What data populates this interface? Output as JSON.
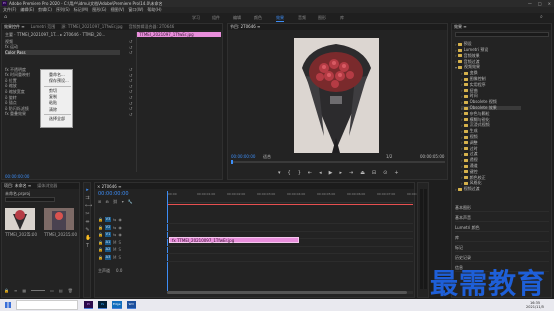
{
  "titlebar": {
    "title": "Adobe Premiere Pro 2020 - C:\\用户\\idmu\\文档\\Adobe\\Premiere Pro\\14.0\\未命名"
  },
  "menubar": {
    "items": [
      "文件(F)",
      "编辑(E)",
      "剪辑(C)",
      "序列(S)",
      "标记(M)",
      "图形(G)",
      "视图(V)",
      "窗口(W)",
      "帮助(H)"
    ]
  },
  "workspaces": {
    "items": [
      "学习",
      "组件",
      "编辑",
      "颜色",
      "效果",
      "音频",
      "图形",
      "库"
    ],
    "active_index": 4
  },
  "effect_controls": {
    "tabs": [
      "效果控件 ≡",
      "Lumetri 范围",
      "源: TTMEI_2021097_1TfwEr.jpg",
      "音频剪辑混合器: 2T0646"
    ],
    "clip_label": "主要 · TTMEI_2021097_1T... ▸ 2T0646 · TTMEI_20...",
    "rows": [
      "视频",
      "fx 运动",
      "Color Pass",
      "",
      "",
      "fx 不透明度",
      "fx 时间重映射",
      "ö 位置",
      "ö 缩放",
      "ö 缩放宽度",
      "ö 旋转",
      "ö 锚点",
      "ö 防闪烁滤镜",
      "fx 重叠效果"
    ],
    "timecode": "00:00:00:00",
    "mini_timecode": "00:00:00:00",
    "mini_clip": "TTMEI_2021097_1TfwEr.jpg"
  },
  "context_menu": {
    "items": [
      {
        "label": "重命名...",
        "enabled": true
      },
      {
        "label": "保存预设...",
        "enabled": true
      },
      {
        "label": "",
        "enabled": false
      },
      {
        "label": "剪切",
        "enabled": true
      },
      {
        "label": "复制",
        "enabled": true
      },
      {
        "label": "粘贴",
        "enabled": true
      },
      {
        "label": "清除",
        "enabled": true
      },
      {
        "label": "",
        "enabled": false
      },
      {
        "label": "选择全部",
        "enabled": true
      }
    ]
  },
  "program_monitor": {
    "tab": "节目: 2T0646 ≡",
    "timecode_left": "00:00:00:00",
    "fit_label": "适合",
    "scale_label": "1/2",
    "timecode_right": "00:00:05:00"
  },
  "project_panel": {
    "tabs": [
      "项目: 未命名 ≡",
      "媒体浏览器"
    ],
    "file_label": "未命名.prproj",
    "thumbnails": [
      "TTMEI_2021...",
      "TTMEI_2021..."
    ],
    "thumb_durations": [
      "5:00",
      "5:00"
    ]
  },
  "timeline": {
    "tab": "× 2T0646 ≡",
    "timecode": "00:00:00:00",
    "ruler_labels": [
      ":00:00",
      "00:00:01:00",
      "00:00:02:00",
      "00:00:03:00",
      "00:00:04:00",
      "00:00:05:00",
      "00:00:06:00",
      "00:00:07:00",
      "00:00:08:00"
    ],
    "tracks": [
      {
        "name": "V3",
        "kind": "video"
      },
      {
        "name": "V2",
        "kind": "video"
      },
      {
        "name": "V1",
        "kind": "video"
      },
      {
        "name": "A1",
        "kind": "audio"
      },
      {
        "name": "A2",
        "kind": "audio"
      },
      {
        "name": "A3",
        "kind": "audio"
      }
    ],
    "master_label": "主声道",
    "master_value": "0.0",
    "clip_name": "fx TTMEI_20210097_1TfwEr.jpg"
  },
  "effects_panel": {
    "title": "效果 ≡",
    "items": [
      {
        "label": "预设",
        "level": 0
      },
      {
        "label": "Lumetri 预设",
        "level": 0
      },
      {
        "label": "音频效果",
        "level": 0
      },
      {
        "label": "音频过渡",
        "level": 0
      },
      {
        "label": "视频效果",
        "level": 0
      },
      {
        "label": "变换",
        "level": 1
      },
      {
        "label": "图像控制",
        "level": 1
      },
      {
        "label": "实用程序",
        "level": 1
      },
      {
        "label": "扭曲",
        "level": 1
      },
      {
        "label": "时间",
        "level": 1
      },
      {
        "label": "Obsolete 视频",
        "level": 1
      },
      {
        "label": "Obsolete 效果",
        "level": 1
      },
      {
        "label": "杂色与颗粒",
        "level": 1
      },
      {
        "label": "模糊与锐化",
        "level": 1
      },
      {
        "label": "沉浸式视频",
        "level": 1
      },
      {
        "label": "生成",
        "level": 1
      },
      {
        "label": "视频",
        "level": 1
      },
      {
        "label": "调整",
        "level": 1
      },
      {
        "label": "过时",
        "level": 1
      },
      {
        "label": "过渡",
        "level": 1
      },
      {
        "label": "透视",
        "level": 1
      },
      {
        "label": "通道",
        "level": 1
      },
      {
        "label": "键控",
        "level": 1
      },
      {
        "label": "颜色校正",
        "level": 1
      },
      {
        "label": "风格化",
        "level": 1
      },
      {
        "label": "视频过渡",
        "level": 0
      }
    ],
    "lower_items": [
      "基本图形",
      "基本声音",
      "Lumetri 颜色",
      "库",
      "标记",
      "历史记录",
      "信息"
    ]
  },
  "taskbar": {
    "apps": [
      "Pr",
      "Ps",
      "Edge",
      "Wd"
    ],
    "time": "16:35",
    "date": "2021/11/5"
  },
  "watermark": {
    "text": "最需教育"
  },
  "colors": {
    "accent": "#3d8df5",
    "clip_pink": "#e98fdc",
    "playhead": "#3d8df5",
    "in_marker": "#e85050"
  }
}
